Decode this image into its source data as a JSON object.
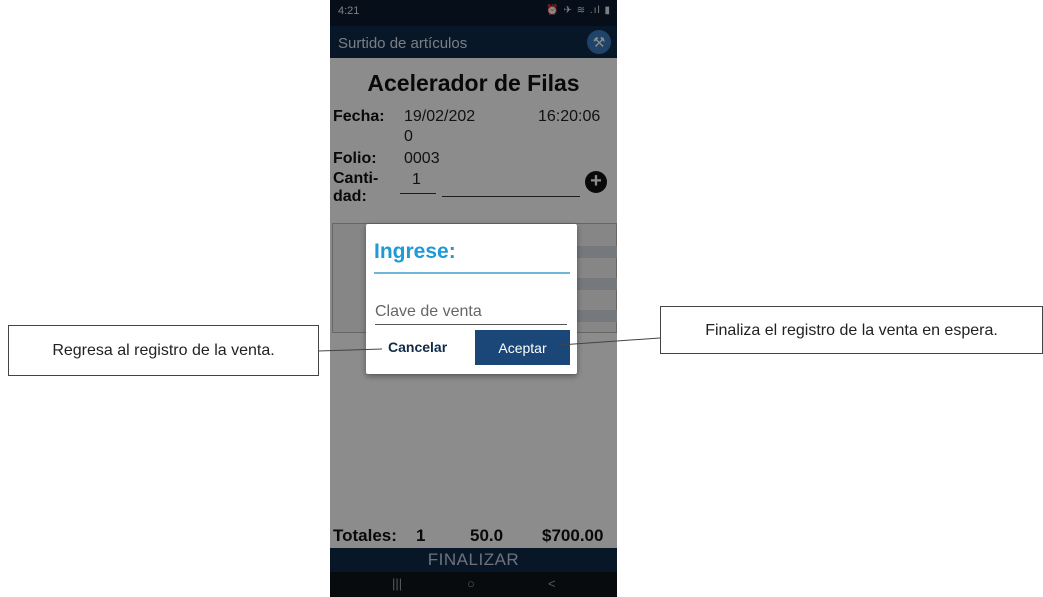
{
  "status_bar": {
    "time": "4:21",
    "icons": "⏰ ✈ ≋ .ıl ▮"
  },
  "app_bar": {
    "title": "Surtido de artículos",
    "wrench_icon": "wrench-icon"
  },
  "main": {
    "heading": "Acelerador de Filas",
    "fecha_label": "Fecha:",
    "fecha_value_line1": "19/02/202",
    "fecha_value_line2": "0",
    "hora_value": "16:20:06",
    "folio_label": "Folio:",
    "folio_value": "0003",
    "cantidad_label_line1": "Canti-",
    "cantidad_label_line2": "dad:",
    "cantidad_value": "1",
    "add_button": "+"
  },
  "totals": {
    "label": "Totales:",
    "count": "1",
    "amount": "50.0",
    "total": "$700.00"
  },
  "finalizar_button": "FINALIZAR",
  "nav_bar": {
    "recent": "|||",
    "home": "○",
    "back": "<"
  },
  "dialog": {
    "title": "Ingrese:",
    "input_placeholder": "Clave de venta",
    "input_value": "",
    "cancel_label": "Cancelar",
    "accept_label": "Aceptar"
  },
  "annotations": {
    "left": "Regresa al registro de la venta.",
    "right": "Finaliza el registro de la venta en espera."
  },
  "colors": {
    "app_bar": "#0e2a48",
    "dialog_title": "#1f9ad6",
    "accept_button": "#1b4778"
  }
}
